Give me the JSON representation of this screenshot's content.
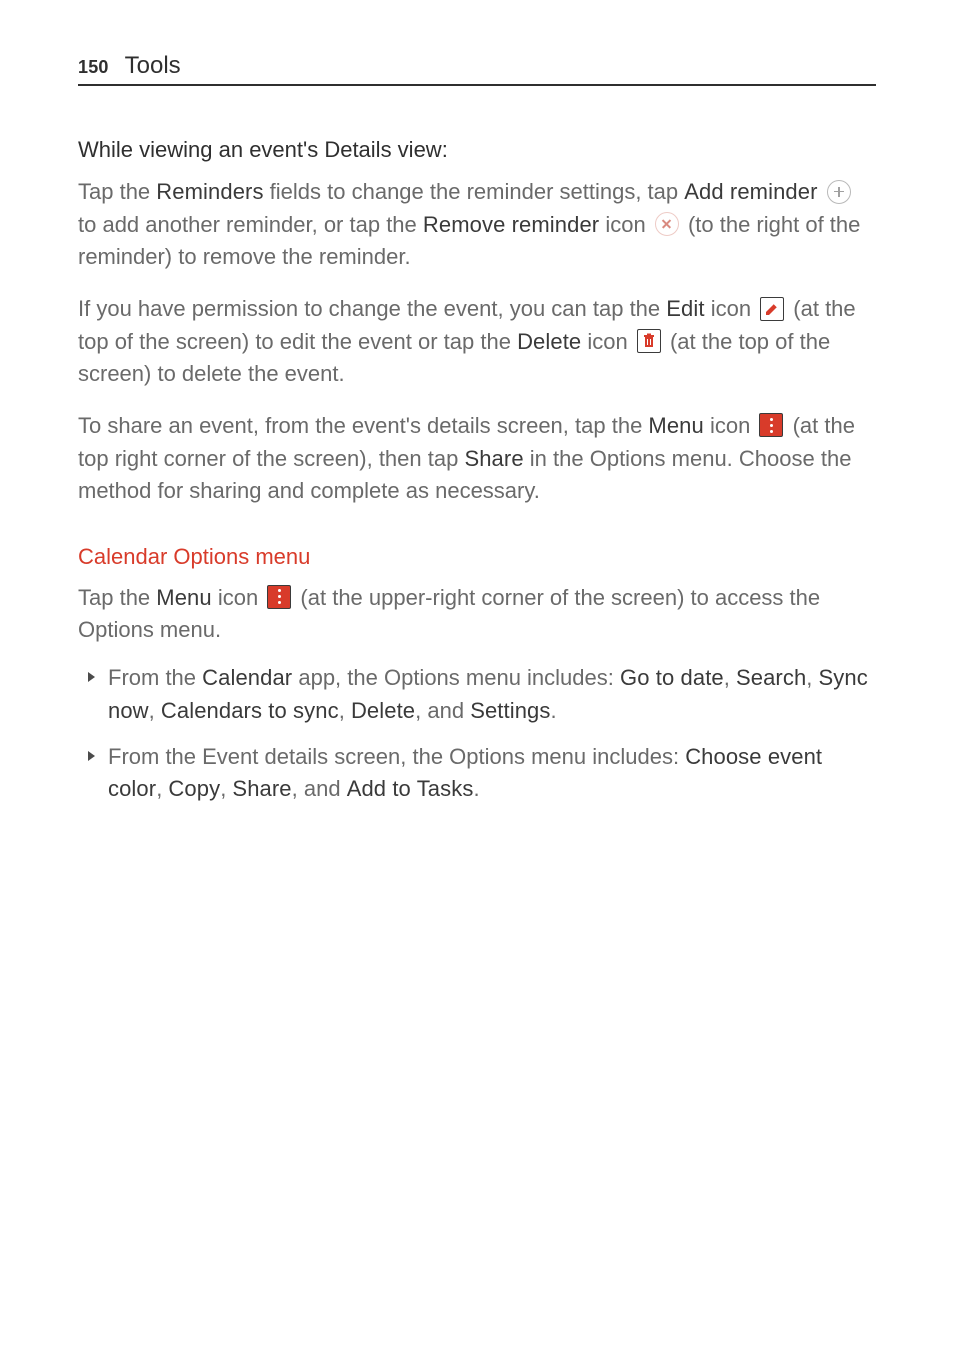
{
  "page_number": "150",
  "header_title": "Tools",
  "heading1": "While viewing an event's Details view:",
  "p1": {
    "t1": "Tap the ",
    "reminders": "Reminders",
    "t2": " fields to change the reminder settings, tap ",
    "add_reminder": "Add reminder",
    "t3": " to add another reminder, or tap the ",
    "remove_reminder": "Remove reminder",
    "t4": " icon ",
    "t5": " (to the right of the reminder) to remove the reminder."
  },
  "p2": {
    "t1": "If you have permission to change the event, you can tap the ",
    "edit": "Edit",
    "t2": " icon ",
    "t3": " (at the top of the screen) to edit the event or tap the ",
    "delete": "Delete",
    "t4": " icon ",
    "t5": " (at the top of the screen) to delete the event."
  },
  "p3": {
    "t1": "To share an event, from the event's details screen, tap the ",
    "menu": "Menu",
    "t2": " icon ",
    "t3": " (at the top right corner of the screen), then tap ",
    "share": "Share",
    "t4": " in the Options menu. Choose the method for sharing and complete as necessary."
  },
  "heading2": "Calendar Options menu",
  "p4": {
    "t1": "Tap the ",
    "menu": "Menu",
    "t2": " icon ",
    "t3": " (at the upper-right corner of the screen) to access the Options menu."
  },
  "bullets": {
    "b1": {
      "t1": "From the ",
      "calendar": "Calendar",
      "t2": " app, the Options menu includes: ",
      "i1": "Go to date",
      "c1": ", ",
      "i2": "Search",
      "c2": ", ",
      "i3": "Sync now",
      "c3": ", ",
      "i4": "Calendars to sync",
      "c4": ", ",
      "i5": "Delete",
      "c5": ", and ",
      "i6": "Settings",
      "c6": "."
    },
    "b2": {
      "t1": "From the Event details screen, the Options menu includes: ",
      "i1": "Choose event color",
      "c1": ", ",
      "i2": "Copy",
      "c2": ", ",
      "i3": "Share",
      "c3": ", and ",
      "i4": "Add to Tasks",
      "c4": "."
    }
  }
}
